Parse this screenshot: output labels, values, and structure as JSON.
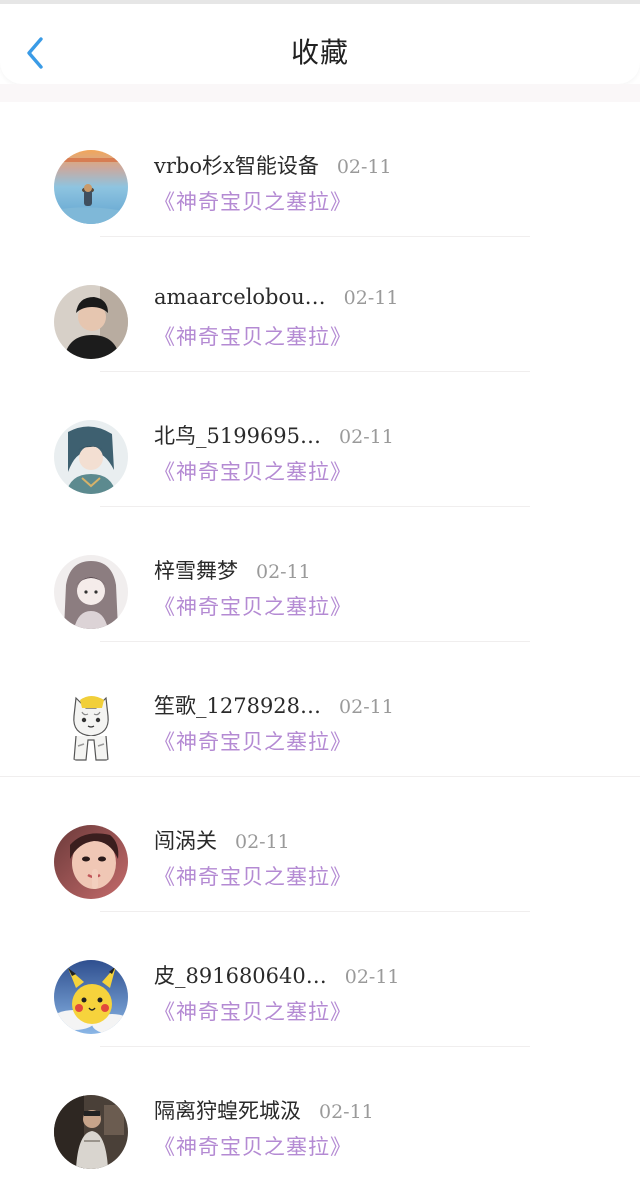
{
  "header": {
    "title": "收藏"
  },
  "items": [
    {
      "username": "vrbo杉x智能设备",
      "date": "02-11",
      "work": "《神奇宝贝之塞拉》",
      "avatar": "sea-sunset-avatar"
    },
    {
      "username": "amaarcelobou…",
      "date": "02-11",
      "work": "《神奇宝贝之塞拉》",
      "avatar": "young-man-avatar"
    },
    {
      "username": "北鸟_5199695…",
      "date": "02-11",
      "work": "《神奇宝贝之塞拉》",
      "avatar": "anime-character-avatar"
    },
    {
      "username": "梓雪舞梦",
      "date": "02-11",
      "work": "《神奇宝贝之塞拉》",
      "avatar": "sketch-girl-avatar"
    },
    {
      "username": "笙歌_1278928…",
      "date": "02-11",
      "work": "《神奇宝贝之塞拉》",
      "avatar": "cat-avatar"
    },
    {
      "username": "闯涡关",
      "date": "02-11",
      "work": "《神奇宝贝之塞拉》",
      "avatar": "girl-portrait-avatar"
    },
    {
      "username": "皮_891680640…",
      "date": "02-11",
      "work": "《神奇宝贝之塞拉》",
      "avatar": "pikachu-avatar"
    },
    {
      "username": "隔离狩蝗死城汲",
      "date": "02-11",
      "work": "《神奇宝贝之塞拉》",
      "avatar": "dark-room-avatar"
    }
  ],
  "colors": {
    "accent_back": "#3a9be6",
    "work_title": "#b48ad3",
    "date": "#9a9a9a"
  }
}
